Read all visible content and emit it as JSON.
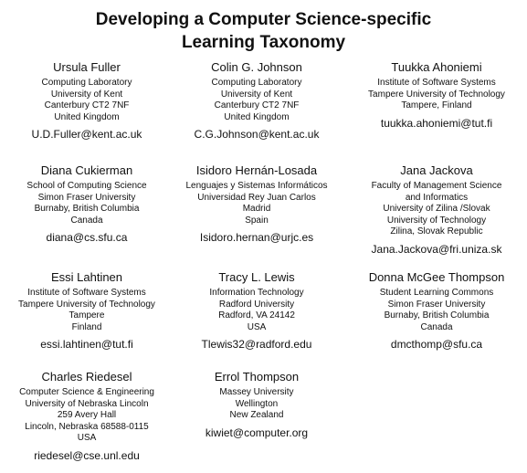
{
  "title_line1": "Developing a Computer Science-specific",
  "title_line2": "Learning Taxonomy",
  "authors": [
    {
      "name": "Ursula Fuller",
      "affiliation": [
        "Computing Laboratory",
        "University of Kent",
        "Canterbury CT2 7NF",
        "United Kingdom"
      ],
      "email": "U.D.Fuller@kent.ac.uk"
    },
    {
      "name": "Colin G. Johnson",
      "affiliation": [
        "Computing Laboratory",
        "University of Kent",
        "Canterbury CT2 7NF",
        "United Kingdom"
      ],
      "email": "C.G.Johnson@kent.ac.uk"
    },
    {
      "name": "Tuukka Ahoniemi",
      "affiliation": [
        "Institute of Software Systems",
        "Tampere University of Technology",
        "Tampere, Finland"
      ],
      "email": "tuukka.ahoniemi@tut.fi"
    },
    {
      "name": "Diana Cukierman",
      "affiliation": [
        "School of Computing Science",
        "Simon Fraser University",
        "Burnaby, British Columbia",
        "Canada"
      ],
      "email": "diana@cs.sfu.ca"
    },
    {
      "name": "Isidoro Hernán-Losada",
      "affiliation": [
        "Lenguajes y Sistemas Informáticos",
        "Universidad Rey Juan Carlos",
        "Madrid",
        "Spain"
      ],
      "email": "Isidoro.hernan@urjc.es"
    },
    {
      "name": "Jana Jackova",
      "affiliation": [
        "Faculty of Management Science",
        "and Informatics",
        "University of Zilina /Slovak",
        "University of Technology",
        "Zilina, Slovak Republic"
      ],
      "email": "Jana.Jackova@fri.uniza.sk"
    },
    {
      "name": "Essi Lahtinen",
      "affiliation": [
        "Institute of Software Systems",
        "Tampere University of Technology",
        "Tampere",
        "Finland"
      ],
      "email": "essi.lahtinen@tut.fi"
    },
    {
      "name": "Tracy L. Lewis",
      "affiliation": [
        "Information Technology",
        "Radford University",
        "Radford, VA 24142",
        "USA"
      ],
      "email": "Tlewis32@radford.edu"
    },
    {
      "name": "Donna McGee Thompson",
      "affiliation": [
        "Student Learning Commons",
        "Simon Fraser University",
        "Burnaby, British Columbia",
        "Canada"
      ],
      "email": "dmcthomp@sfu.ca"
    },
    {
      "name": "Charles Riedesel",
      "affiliation": [
        "Computer Science & Engineering",
        "University of Nebraska Lincoln",
        "259 Avery Hall",
        "Lincoln, Nebraska 68588-0115",
        "USA"
      ],
      "email": "riedesel@cse.unl.edu"
    },
    {
      "name": "Errol Thompson",
      "affiliation": [
        "Massey University",
        "Wellington",
        "New Zealand"
      ],
      "email": "kiwiet@computer.org"
    }
  ]
}
